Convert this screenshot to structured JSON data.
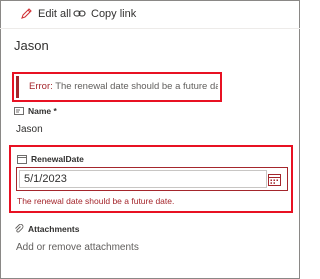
{
  "toolbar": {
    "edit_label": "Edit all",
    "copy_label": "Copy link"
  },
  "record": {
    "title": "Jason"
  },
  "error_banner": {
    "prefix": "Error:",
    "message": " The renewal date should be a future date."
  },
  "fields": {
    "name": {
      "label": "Name *",
      "value": "Jason"
    },
    "renewal_date": {
      "label": "RenewalDate",
      "value": "5/1/2023",
      "error": "The renewal date should be a future date."
    },
    "attachments": {
      "label": "Attachments",
      "action": "Add or remove attachments"
    }
  },
  "icons": {
    "edit": "pencil-icon",
    "copy": "link-icon",
    "name": "text-field-icon",
    "date": "calendar-icon",
    "attachments": "paperclip-icon"
  },
  "colors": {
    "error_red": "#a4262c",
    "highlight_red": "#e81123",
    "edit_icon": "#d13438"
  }
}
